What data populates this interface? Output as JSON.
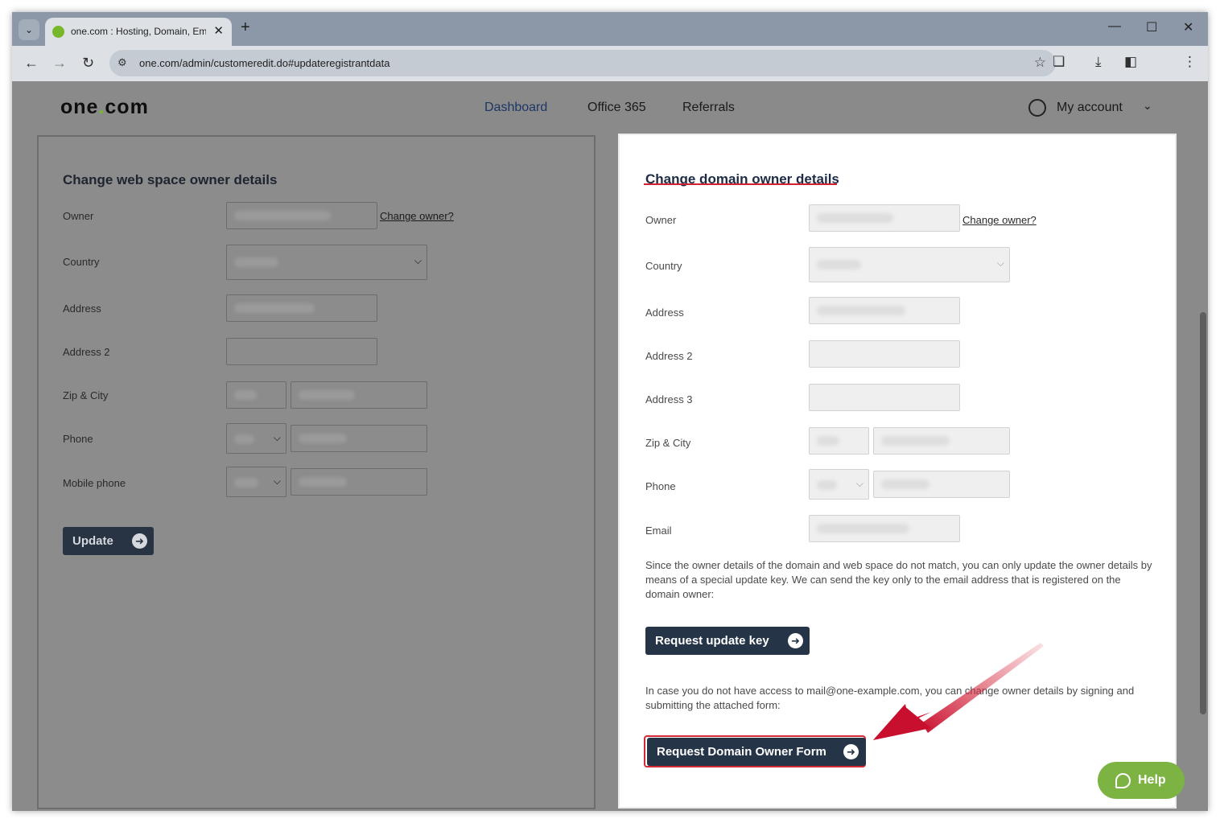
{
  "browser": {
    "tab_title": "one.com : Hosting, Domain, Em",
    "url": "one.com/admin/customeredit.do#updateregistrantdata",
    "icons": [
      "tab-search-icon",
      "favicon-icon",
      "close-tab-icon",
      "new-tab-icon",
      "minimize-icon",
      "maximize-icon",
      "close-window-icon",
      "back-icon",
      "forward-icon",
      "reload-icon",
      "site-info-icon",
      "bookmark-star-icon",
      "extensions-icon",
      "downloads-icon",
      "side-panel-icon",
      "menu-dots-icon"
    ]
  },
  "site": {
    "logo_left": "one",
    "logo_dot": ".",
    "logo_right": "com",
    "nav": {
      "dashboard": "Dashboard",
      "office365": "Office 365",
      "referrals": "Referrals"
    },
    "account": "My account"
  },
  "left_panel": {
    "title": "Change web space owner details",
    "labels": {
      "owner": "Owner",
      "country": "Country",
      "address": "Address",
      "address2": "Address 2",
      "zip_city": "Zip & City",
      "phone": "Phone",
      "mobile": "Mobile phone"
    },
    "change_owner_link": "Change owner?",
    "update_button": "Update"
  },
  "right_panel": {
    "title": "Change domain owner details",
    "labels": {
      "owner": "Owner",
      "country": "Country",
      "address": "Address",
      "address2": "Address 2",
      "address3": "Address 3",
      "zip_city": "Zip & City",
      "phone": "Phone",
      "email": "Email"
    },
    "change_owner_link": "Change owner?",
    "info_text": "Since the owner details of the domain and web space do not match, you can only update the owner details by means of a special update key. We can send the key only to the email address that is registered on the domain owner:",
    "request_key_button": "Request update key",
    "info_text2": "In case you do not have access to mail@one-example.com, you can change owner details by signing and submitting the attached form:",
    "request_form_button": "Request Domain Owner Form"
  },
  "help_button": "Help",
  "colors": {
    "brand_green": "#76b82a",
    "button_navy": "#253447",
    "highlight_red": "#d32a36",
    "help_green": "#7cb342"
  }
}
